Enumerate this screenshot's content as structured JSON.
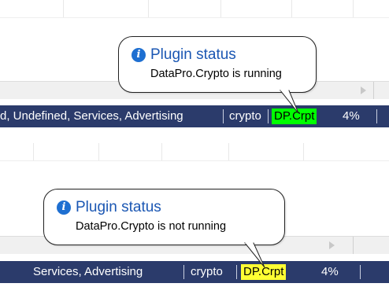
{
  "panels": [
    {
      "state": "running",
      "tooltip": {
        "icon": "info-icon",
        "title": "Plugin status",
        "message": "DataPro.Crypto is running"
      },
      "statusbar": {
        "categories_text": "d, Undefined, Services, Advertising",
        "tag_text": "crypto",
        "plugin_badge": "DP.Crpt",
        "badge_color": "#00ff00",
        "percent": "4%"
      }
    },
    {
      "state": "not running",
      "tooltip": {
        "icon": "info-icon",
        "title": "Plugin status",
        "message": "DataPro.Crypto is not running"
      },
      "statusbar": {
        "categories_text": "Services, Advertising",
        "tag_text": "crypto",
        "plugin_badge": "DP.Crpt",
        "badge_color": "#ffff33",
        "percent": "4%"
      }
    }
  ],
  "colors": {
    "statusbar_bg": "#2b3b6b",
    "tooltip_title": "#1b57b3",
    "info_icon": "#1e6fd1"
  }
}
